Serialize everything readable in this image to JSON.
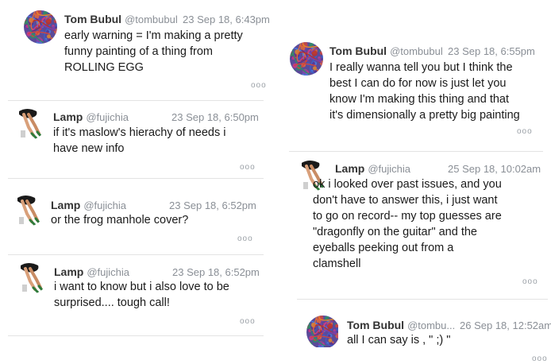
{
  "more_glyph": "ooo",
  "left_column": [
    {
      "user": "Tom Bubul",
      "handle": "@tombubul",
      "time": "23 Sep 18, 6:43pm",
      "avatar": "tom-avatar",
      "lines": [
        "early warning = I'm making a pretty",
        "funny painting of a thing from",
        "ROLLING EGG"
      ]
    },
    {
      "user": "Lamp",
      "handle": "@fujichia",
      "time": "23 Sep 18, 6:50pm",
      "avatar": "lamp-avatar",
      "lines": [
        "if it's maslow's hierachy of needs i",
        "have new info"
      ]
    },
    {
      "user": "Lamp",
      "handle": "@fujichia",
      "time": "23 Sep 18, 6:52pm",
      "avatar": "lamp-avatar",
      "lines": [
        "or the frog manhole cover?"
      ]
    },
    {
      "user": "Lamp",
      "handle": "@fujichia",
      "time": "23 Sep 18, 6:52pm",
      "avatar": "lamp-avatar",
      "lines": [
        "i want to know but i also love to be",
        "surprised.... tough call!"
      ]
    }
  ],
  "right_column": [
    {
      "user": "Tom Bubul",
      "handle": "@tombubul",
      "time": "23 Sep 18, 6:55pm",
      "avatar": "tom-avatar",
      "lines": [
        "I really wanna tell you but I think the",
        "best I can do for now is just let you",
        "know I'm making this thing and that",
        "it's dimensionally a pretty big painting"
      ]
    },
    {
      "user": "Lamp",
      "handle": "@fujichia",
      "time": "25 Sep 18, 10:02am",
      "avatar": "lamp-avatar",
      "lines": [
        "ok i looked over past issues, and you",
        "don't have to answer this, i just want",
        "to go on record-- my top guesses are",
        "\"dragonfly on the guitar\" and the",
        "eyeballs peeking out from a",
        "clamshell"
      ]
    },
    {
      "user": "Tom Bubul",
      "handle": "@tombu...",
      "time": "26 Sep 18, 12:52am",
      "avatar": "tom-avatar",
      "lines": [
        "all I can say is , \" ;) \""
      ]
    }
  ]
}
